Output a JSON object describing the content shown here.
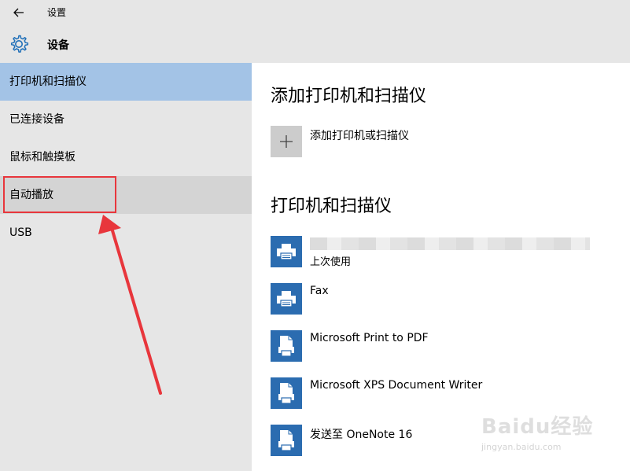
{
  "window": {
    "title": "设置",
    "back_icon": "back-arrow-icon"
  },
  "header": {
    "icon": "gear-icon",
    "title": "设备"
  },
  "sidebar": {
    "items": [
      {
        "label": "打印机和扫描仪",
        "state": "selected"
      },
      {
        "label": "已连接设备",
        "state": "normal"
      },
      {
        "label": "鼠标和触摸板",
        "state": "normal"
      },
      {
        "label": "自动播放",
        "state": "hover"
      },
      {
        "label": "USB",
        "state": "normal"
      }
    ]
  },
  "main": {
    "add_section": {
      "heading": "添加打印机和扫描仪",
      "add_label": "添加打印机或扫描仪"
    },
    "devices_section": {
      "heading": "打印机和扫描仪",
      "devices": [
        {
          "name": "",
          "sub": "上次使用",
          "icon": "printer-icon"
        },
        {
          "name": "Fax",
          "sub": "",
          "icon": "printer-icon"
        },
        {
          "name": "Microsoft Print to PDF",
          "sub": "",
          "icon": "document-printer-icon"
        },
        {
          "name": "Microsoft XPS Document Writer",
          "sub": "",
          "icon": "document-printer-icon"
        },
        {
          "name": "发送至 OneNote 16",
          "sub": "",
          "icon": "document-printer-icon"
        }
      ]
    }
  },
  "watermark": {
    "brand": "Baidu经验",
    "url": "jingyan.baidu.com"
  },
  "colors": {
    "selected_bg": "#a3c3e6",
    "hover_bg": "#d4d4d4",
    "annotation_red": "#e8363c",
    "icon_blue": "#2b6cb0"
  }
}
